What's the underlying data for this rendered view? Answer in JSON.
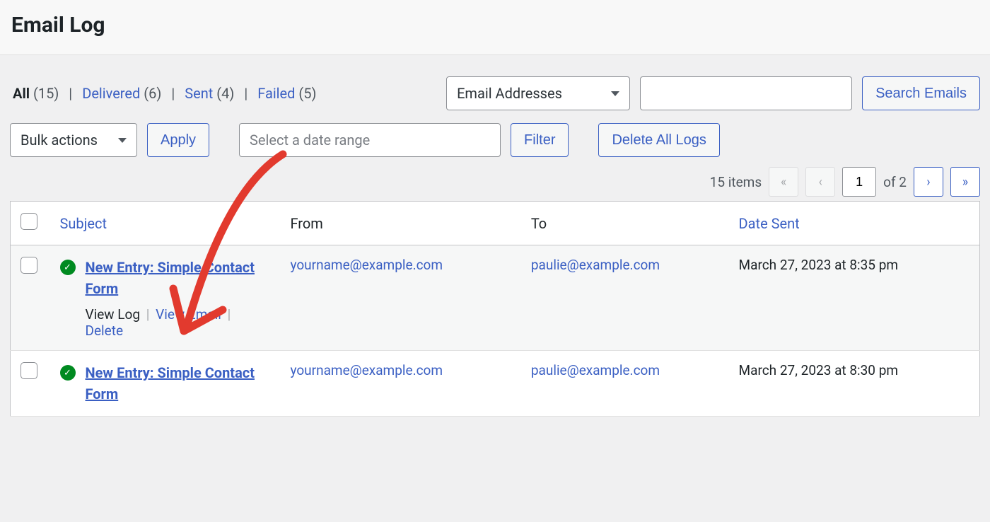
{
  "header": {
    "title": "Email Log"
  },
  "filters": {
    "statuses": [
      {
        "label": "All",
        "count": "(15)",
        "current": true
      },
      {
        "label": "Delivered",
        "count": "(6)",
        "current": false
      },
      {
        "label": "Sent",
        "count": "(4)",
        "current": false
      },
      {
        "label": "Failed",
        "count": "(5)",
        "current": false
      }
    ],
    "email_dropdown": "Email Addresses",
    "search_button": "Search Emails"
  },
  "actions": {
    "bulk_label": "Bulk actions",
    "apply": "Apply",
    "date_placeholder": "Select a date range",
    "filter": "Filter",
    "delete_all": "Delete All Logs"
  },
  "pagination": {
    "items_text": "15 items",
    "page": "1",
    "of_text": "of 2"
  },
  "table": {
    "headers": {
      "subject": "Subject",
      "from": "From",
      "to": "To",
      "date": "Date Sent"
    },
    "rows": [
      {
        "subject": "New Entry: Simple Contact Form",
        "from": "yourname@example.com",
        "to": "paulie@example.com",
        "date": "March 27, 2023 at 8:35 pm",
        "actions": {
          "view_log": "View Log",
          "view_email": "View Email",
          "delete": "Delete"
        },
        "show_actions": true
      },
      {
        "subject": "New Entry: Simple Contact Form",
        "from": "yourname@example.com",
        "to": "paulie@example.com",
        "date": "March 27, 2023 at 8:30 pm",
        "show_actions": false
      }
    ]
  }
}
